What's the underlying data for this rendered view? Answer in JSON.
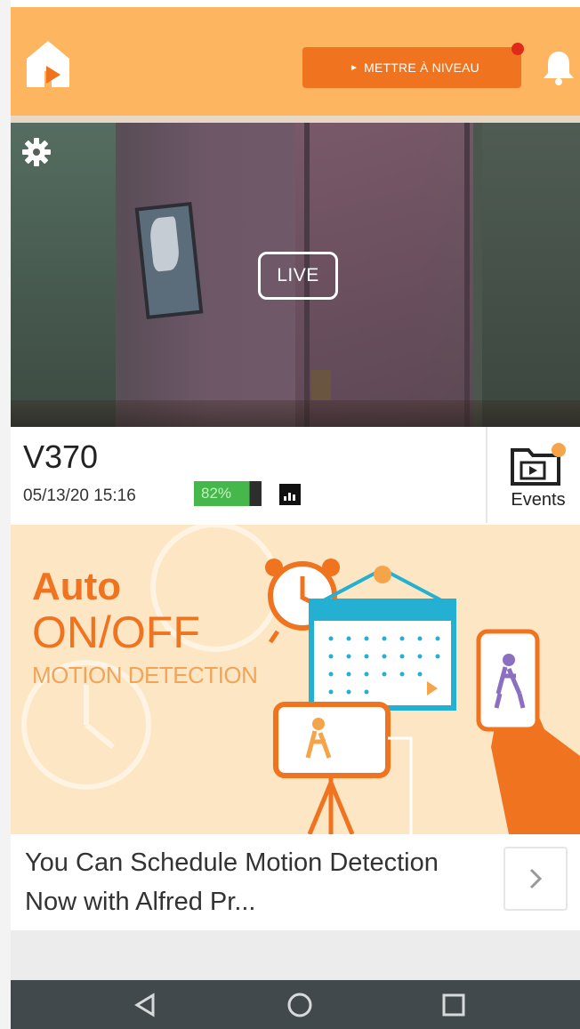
{
  "header": {
    "upgrade_label": "METTRE À NIVEAU"
  },
  "camera": {
    "live_label": "LIVE",
    "name": "V370",
    "timestamp": "05/13/20 15:16",
    "battery": "82%",
    "battery_level": 0.82,
    "events_label": "Events"
  },
  "promo": {
    "line1": "Auto",
    "line2": "ON/OFF",
    "line3": "MOTION DETECTION",
    "caption": "You Can Schedule Motion Detection Now with Alfred Pr..."
  },
  "colors": {
    "brand": "#fdb65f",
    "accent": "#f0731f",
    "battery_green": "#46b74a",
    "nav_bar": "#42494d"
  },
  "icons": [
    "home-icon",
    "bell-icon",
    "gear-icon",
    "signal-icon",
    "events-folder-icon",
    "chevron-right-icon",
    "back-icon",
    "home-circle-icon",
    "recent-apps-icon"
  ]
}
